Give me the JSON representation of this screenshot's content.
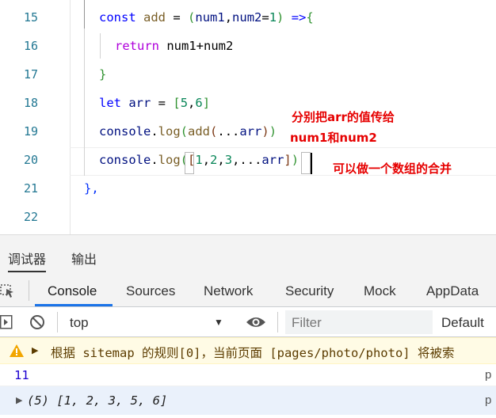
{
  "editor": {
    "lines": [
      {
        "n": "15"
      },
      {
        "n": "16"
      },
      {
        "n": "17"
      },
      {
        "n": "18"
      },
      {
        "n": "19"
      },
      {
        "n": "20"
      },
      {
        "n": "21"
      },
      {
        "n": "22"
      }
    ],
    "tokens": {
      "l15_const": "const",
      "l15_add": "add",
      "l15_eq": " = ",
      "l15_paren": "(",
      "l15_num1": "num1",
      "l15_comma": ",",
      "l15_num2": "num2",
      "l15_eq2": "=",
      "l15_one": "1",
      "l15_close": ")",
      "l15_arrow": " =>",
      "l15_brace": "{",
      "l16_return": "return",
      "l16_expr": " num1+num2",
      "l17_brace": "}",
      "l18_let": "let",
      "l18_arr": "arr",
      "l18_eq": " = ",
      "l18_lb": "[",
      "l18_5": "5",
      "l18_c": ",",
      "l18_6": "6",
      "l18_rb": "]",
      "l19_console": "console",
      "l19_dot": ".",
      "l19_log": "log",
      "l19_p1": "(",
      "l19_add": "add",
      "l19_p2": "(",
      "l19_spread": "...",
      "l19_arr": "arr",
      "l19_p3": ")",
      "l19_p4": ")",
      "l20_console": "console",
      "l20_dot": ".",
      "l20_log": "log",
      "l20_p1": "(",
      "l20_lb": "[",
      "l20_1": "1",
      "l20_c1": ",",
      "l20_2": "2",
      "l20_c2": ",",
      "l20_3": "3",
      "l20_c3": ",",
      "l20_spread": "...",
      "l20_arr": "arr",
      "l20_rb": "]",
      "l20_p2": ")",
      "l21_close": "},"
    },
    "annotations": {
      "spread_args_line1": "分别把arr的值传给",
      "spread_args_line2": "num1和num2",
      "merge_array": "可以做一个数组的合并"
    }
  },
  "panel": {
    "tabs": [
      "调试器",
      "输出"
    ]
  },
  "devtools": {
    "tabs": [
      "Console",
      "Sources",
      "Network",
      "Security",
      "Mock",
      "AppData"
    ],
    "active_tab": "Console",
    "context_select": "top",
    "filter_placeholder": "Filter",
    "levels": "Default"
  },
  "console": {
    "warning_text": "根据 sitemap 的规则[0]，当前页面 [pages/photo/photo] 将被索",
    "log_value": "11",
    "log_source": "p",
    "array_summary": "(5) [1, 2, 3, 5, 6]",
    "array_source": "p"
  },
  "colors": {
    "accent": "#1a73e8",
    "annotation": "#e60000",
    "warning_bg": "#fffbe5",
    "line_number": "#237893"
  }
}
